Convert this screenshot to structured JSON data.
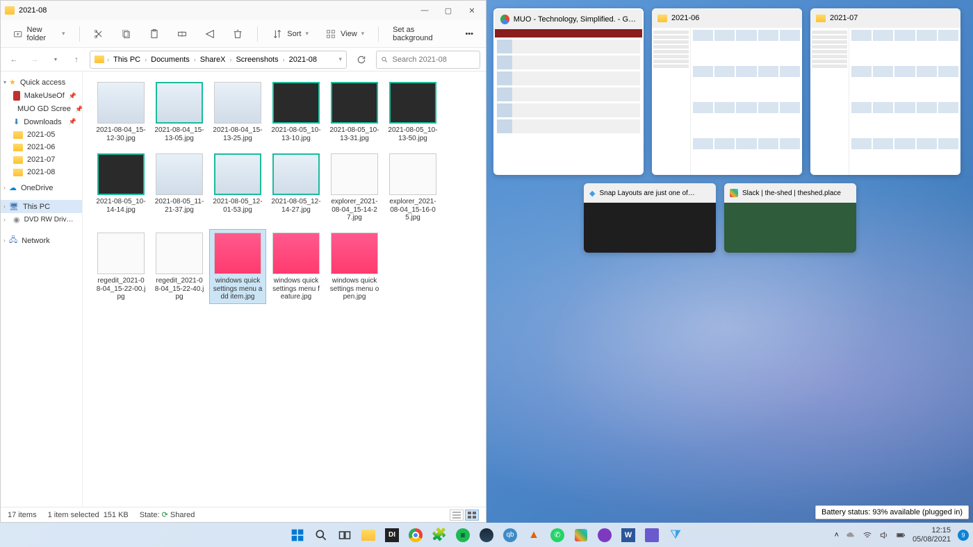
{
  "window": {
    "title": "2021-08",
    "buttons": {
      "min": "—",
      "max": "▢",
      "close": "✕"
    }
  },
  "toolbar": {
    "new_folder": "New folder",
    "sort": "Sort",
    "view": "View",
    "background": "Set as background"
  },
  "breadcrumbs": [
    "This PC",
    "Documents",
    "ShareX",
    "Screenshots",
    "2021-08"
  ],
  "search": {
    "placeholder": "Search 2021-08"
  },
  "sidebar": {
    "quick_access": "Quick access",
    "pinned": [
      {
        "label": "MakeUseOf",
        "icon": "red"
      },
      {
        "label": "MUO GD Scree",
        "icon": "folder"
      },
      {
        "label": "Downloads",
        "icon": "down"
      },
      {
        "label": "2021-05",
        "icon": "folder"
      },
      {
        "label": "2021-06",
        "icon": "folder"
      },
      {
        "label": "2021-07",
        "icon": "folder"
      },
      {
        "label": "2021-08",
        "icon": "folder"
      }
    ],
    "onedrive": "OneDrive",
    "thispc": "This PC",
    "dvd": "DVD RW Drive (D:) A",
    "network": "Network"
  },
  "files": [
    {
      "name": "2021-08-04_15-12-30.jpg",
      "style": "light"
    },
    {
      "name": "2021-08-04_15-13-05.jpg",
      "style": "light teal"
    },
    {
      "name": "2021-08-04_15-13-25.jpg",
      "style": "light"
    },
    {
      "name": "2021-08-05_10-13-10.jpg",
      "style": "dark teal"
    },
    {
      "name": "2021-08-05_10-13-31.jpg",
      "style": "dark teal"
    },
    {
      "name": "2021-08-05_10-13-50.jpg",
      "style": "dark teal"
    },
    {
      "name": "2021-08-05_10-14-14.jpg",
      "style": "dark teal"
    },
    {
      "name": "2021-08-05_11-21-37.jpg",
      "style": "light"
    },
    {
      "name": "2021-08-05_12-01-53.jpg",
      "style": "light teal"
    },
    {
      "name": "2021-08-05_12-14-27.jpg",
      "style": "light teal"
    },
    {
      "name": "explorer_2021-08-04_15-14-27.jpg",
      "style": "white"
    },
    {
      "name": "explorer_2021-08-04_15-16-05.jpg",
      "style": "white"
    },
    {
      "name": "regedit_2021-08-04_15-22-00.jpg",
      "style": "white"
    },
    {
      "name": "regedit_2021-08-04_15-22-40.jpg",
      "style": "white"
    },
    {
      "name": "windows quick settings menu add item.jpg",
      "style": "pink",
      "selected": true
    },
    {
      "name": "windows quick settings menu feature.jpg",
      "style": "pink"
    },
    {
      "name": "windows quick settings menu open.jpg",
      "style": "pink"
    }
  ],
  "status": {
    "items": "17 items",
    "selected": "1 item selected",
    "size": "151 KB",
    "state_label": "State:",
    "state_value": "Shared"
  },
  "snap": {
    "windows": [
      {
        "title": "MUO - Technology, Simplified. - Goog…",
        "icon": "chrome",
        "kind": "web"
      },
      {
        "title": "2021-06",
        "icon": "folder",
        "kind": "explorer"
      },
      {
        "title": "2021-07",
        "icon": "folder",
        "kind": "explorer"
      }
    ],
    "row2": [
      {
        "title": "Snap Layouts are just one of…",
        "icon": "vscode",
        "kind": "dark"
      },
      {
        "title": "Slack | the-shed | theshed.place",
        "icon": "slack",
        "kind": "slack"
      }
    ]
  },
  "taskbar": {
    "apps": [
      "start",
      "search",
      "taskview",
      "explorer",
      "app-d",
      "chrome",
      "puzzle",
      "spotify",
      "steam",
      "qbit",
      "vlc",
      "whatsapp",
      "slack",
      "opera",
      "word",
      "app-x",
      "vscode"
    ]
  },
  "tray": {
    "time": "12:15",
    "date": "05/08/2021",
    "notif_count": "9",
    "battery_tooltip": "Battery status: 93% available (plugged in)"
  }
}
